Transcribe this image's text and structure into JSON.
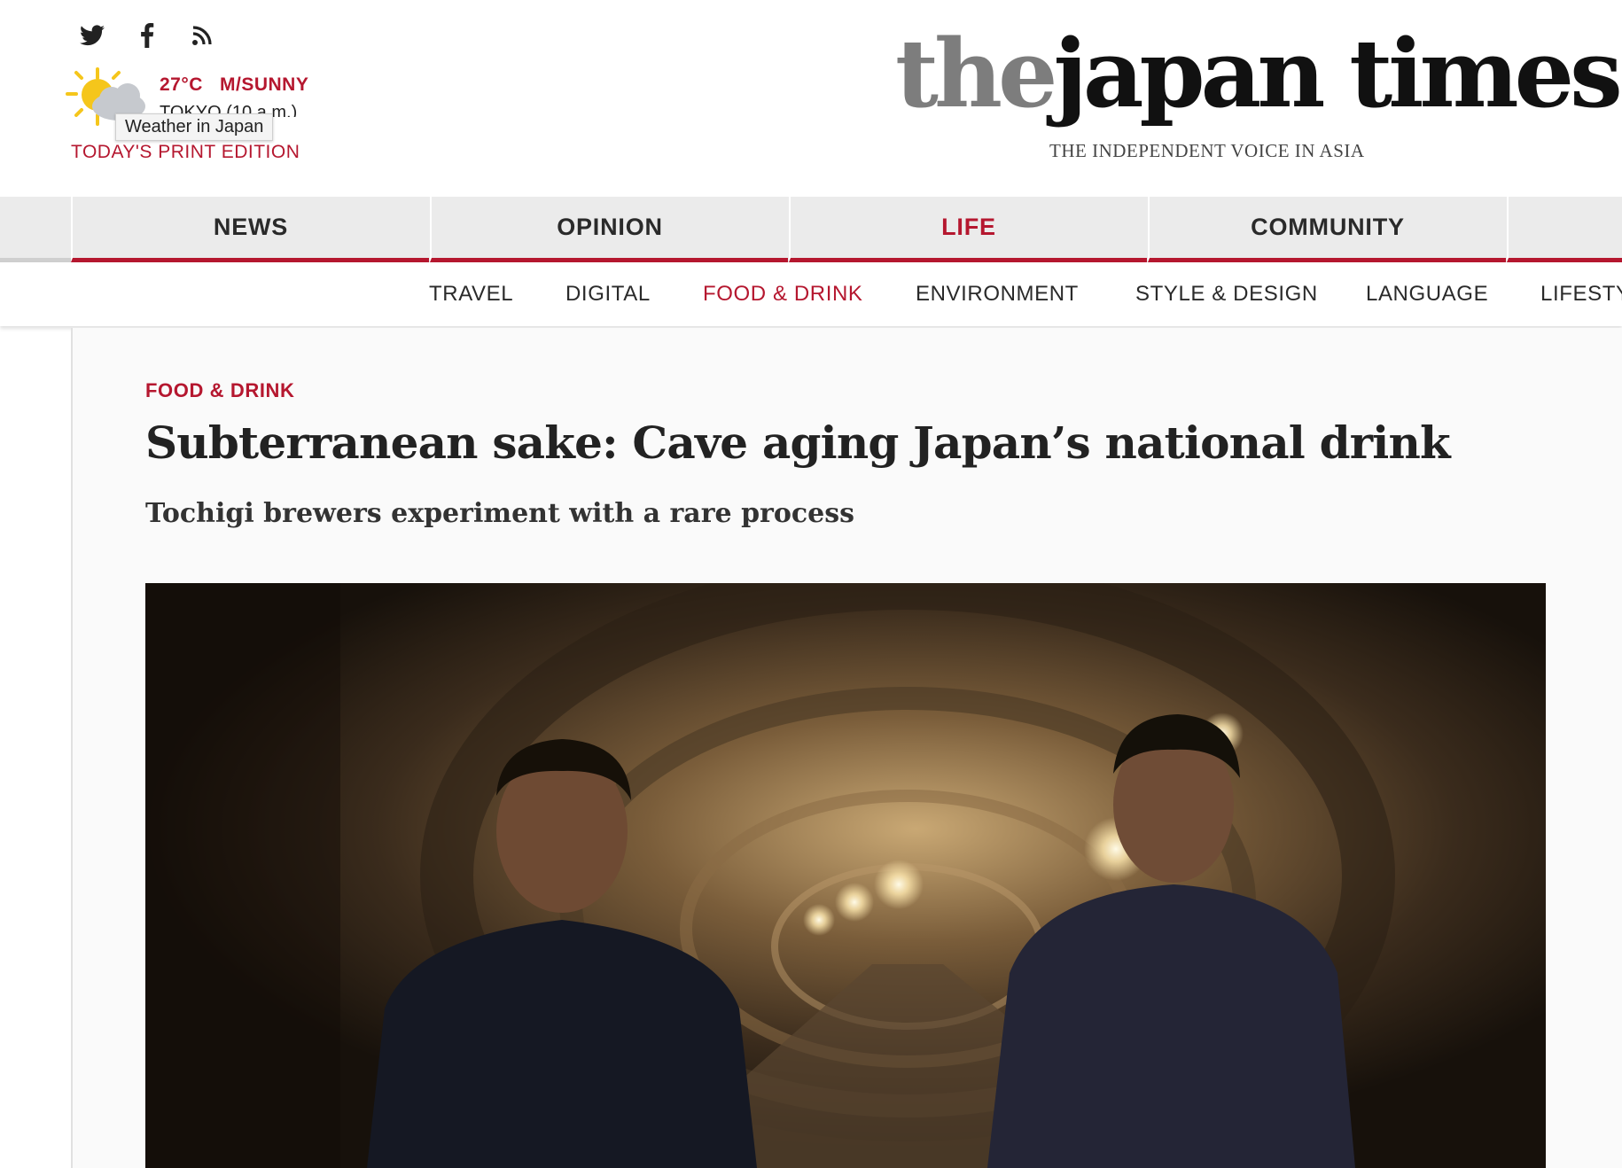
{
  "header": {
    "social": [
      {
        "icon": "twitter-icon"
      },
      {
        "icon": "facebook-icon"
      },
      {
        "icon": "rss-icon"
      }
    ],
    "weather": {
      "temp": "27°C",
      "condition": "M/SUNNY",
      "location": "TOKYO (10 a.m.)",
      "tooltip": "Weather in Japan"
    },
    "print_edition": "TODAY'S PRINT EDITION",
    "logo": {
      "the": "the",
      "rest": "japan times"
    },
    "tagline": "THE INDEPENDENT VOICE IN ASIA"
  },
  "nav": {
    "primary": [
      {
        "label": "NEWS",
        "active": false
      },
      {
        "label": "OPINION",
        "active": false
      },
      {
        "label": "LIFE",
        "active": true
      },
      {
        "label": "COMMUNITY",
        "active": false
      }
    ],
    "secondary": [
      {
        "label": "TRAVEL",
        "active": false
      },
      {
        "label": "DIGITAL",
        "active": false
      },
      {
        "label": "FOOD & DRINK",
        "active": true
      },
      {
        "label": "ENVIRONMENT",
        "active": false
      },
      {
        "label": "STYLE & DESIGN",
        "active": false
      },
      {
        "label": "LANGUAGE",
        "active": false
      },
      {
        "label": "LIFESTY",
        "active": false
      }
    ]
  },
  "article": {
    "kicker": "FOOD & DRINK",
    "headline": "Subterranean sake: Cave aging Japan’s national drink",
    "dek": "Tochigi brewers experiment with a rare process"
  },
  "colors": {
    "accent": "#b5172f",
    "nav_bg": "#ebebeb",
    "text": "#222222"
  }
}
